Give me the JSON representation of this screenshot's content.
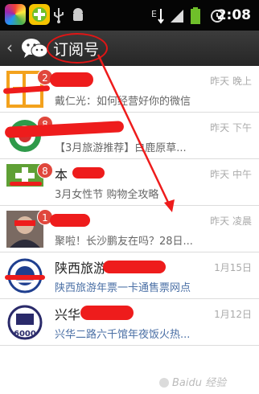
{
  "status_bar": {
    "time": "2:08"
  },
  "header": {
    "back_icon": "‹",
    "title": "订阅号"
  },
  "rows": [
    {
      "name": "",
      "time": "昨天 晚上",
      "preview": "戴仁光：如何经营好你的微信",
      "badge": "2",
      "avatar": "orange-logo"
    },
    {
      "name": "",
      "time": "昨天 下午",
      "preview": "【3月旅游推荐】白鹿原草...",
      "badge": "8",
      "avatar": "green-emblem"
    },
    {
      "name": "本",
      "time": "昨天 中午",
      "preview": "3月女性节 购物全攻略",
      "badge": "8",
      "avatar": "green-logo"
    },
    {
      "name": "",
      "time": "昨天 凌晨",
      "preview": "聚啦！长沙鹏友在吗？28日...",
      "badge": "1",
      "avatar": "person-photo"
    },
    {
      "name": "陕西旅游",
      "time": "1月15日",
      "preview": "陕西旅游年票一卡通售票网点",
      "badge": "",
      "avatar": "blue-seal"
    },
    {
      "name": "兴华",
      "time": "1月12日",
      "preview": "兴华二路六千馆年夜饭火热...",
      "badge": "",
      "avatar": "seal-6000"
    }
  ],
  "watermark": {
    "text": "Baidu 经验"
  }
}
